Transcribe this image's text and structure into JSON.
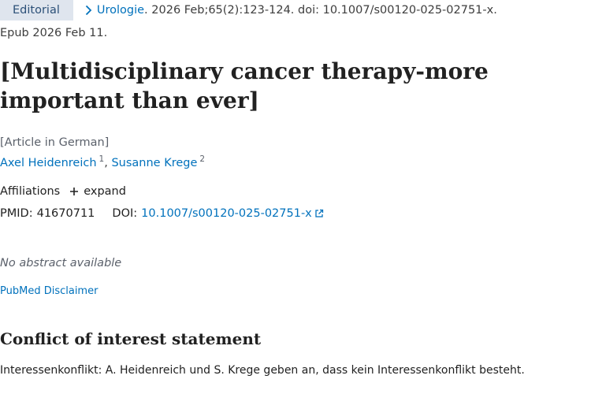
{
  "citation": {
    "badge": "Editorial",
    "journal": "Urologie",
    "details": ". 2026 Feb;65(2):123-124. doi: 10.1007/s00120-025-02751-x.",
    "epub": "Epub 2026 Feb 11."
  },
  "article": {
    "title": "[Multidisciplinary cancer therapy-more important than ever]",
    "language": "[Article in German]",
    "authors": [
      {
        "name": "Axel Heidenreich",
        "sup": "1"
      },
      {
        "name": "Susanne Krege",
        "sup": "2"
      }
    ],
    "author_separator": ","
  },
  "affiliations": {
    "label": "Affiliations",
    "expand_label": "expand"
  },
  "identifiers": {
    "pmid_label": "PMID:",
    "pmid": "41670711",
    "doi_label": "DOI:",
    "doi": "10.1007/s00120-025-02751-x"
  },
  "abstract": {
    "text": "No abstract available"
  },
  "disclaimer": {
    "label": "PubMed Disclaimer"
  },
  "conflict": {
    "heading": "Conflict of interest statement",
    "text": "Interessenkonflikt: A. Heidenreich und S. Krege geben an, dass kein Interessenkonflikt besteht."
  },
  "colors": {
    "link": "#0071bc",
    "badge_bg": "#dfe5ee",
    "badge_text": "#2c5078",
    "muted": "#5b616b"
  },
  "icons": {
    "breadcrumb": "chevron-right-icon",
    "expand": "plus-icon",
    "external": "external-link-icon"
  }
}
